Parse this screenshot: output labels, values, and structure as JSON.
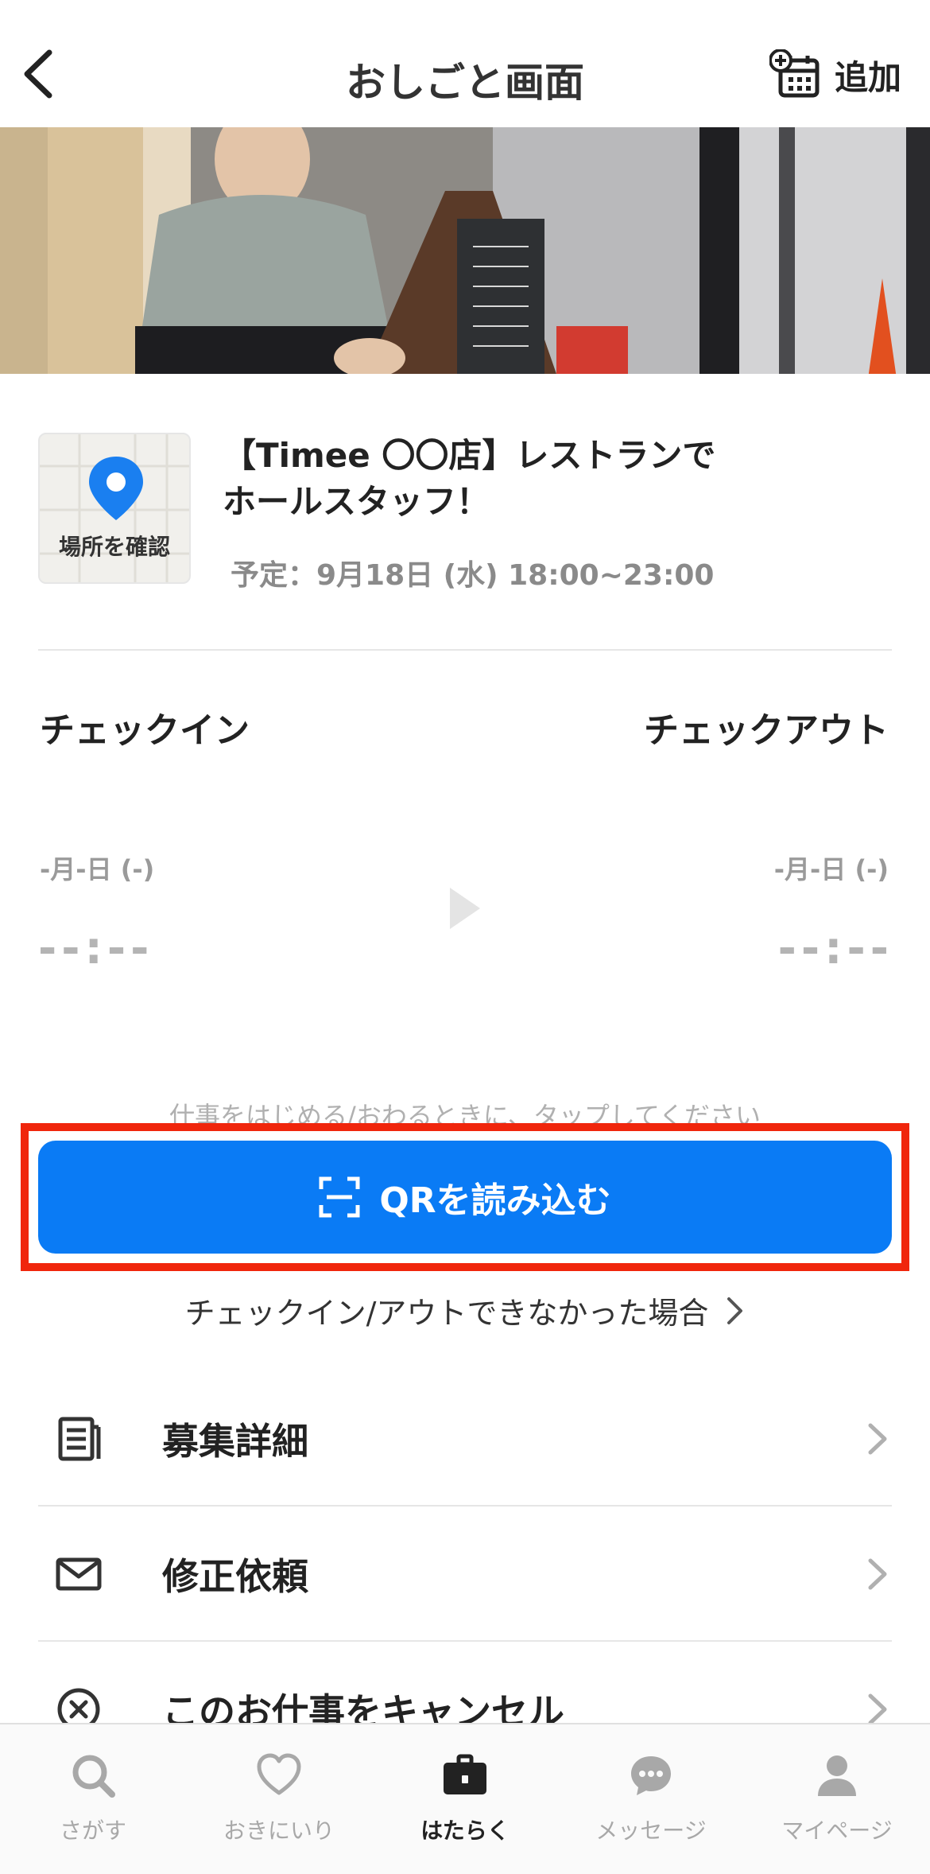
{
  "header": {
    "title": "おしごと画面",
    "add_label": "追加"
  },
  "job": {
    "map_label": "場所を確認",
    "title_line1": "【Timee 〇〇店】レストランで",
    "title_line2": "ホールスタッフ！",
    "schedule": "予定：9月18日 (水) 18:00~23:00"
  },
  "checkin": {
    "label": "チェックイン",
    "date": "-月-日 (-)",
    "time": "--:--"
  },
  "checkout": {
    "label": "チェックアウト",
    "date": "-月-日 (-)",
    "time": "--:--"
  },
  "hint": "仕事をはじめる/おわるときに、タップしてください",
  "qr_button": {
    "label": "QRを読み込む"
  },
  "fail_link": {
    "label": "チェックイン/アウトできなかった場合"
  },
  "menu": [
    {
      "label": "募集詳細",
      "icon": "document-icon"
    },
    {
      "label": "修正依頼",
      "icon": "mail-icon"
    },
    {
      "label": "このお仕事をキャンセル",
      "icon": "cancel-circle-icon"
    }
  ],
  "tabs": [
    {
      "label": "さがす",
      "icon": "search-icon",
      "active": false
    },
    {
      "label": "おきにいり",
      "icon": "heart-icon",
      "active": false
    },
    {
      "label": "はたらく",
      "icon": "briefcase-icon",
      "active": true
    },
    {
      "label": "メッセージ",
      "icon": "chat-icon",
      "active": false
    },
    {
      "label": "マイページ",
      "icon": "person-icon",
      "active": false
    }
  ],
  "colors": {
    "primary": "#0a7bf5",
    "highlight": "#f0260c",
    "pin": "#1a7ff0"
  }
}
